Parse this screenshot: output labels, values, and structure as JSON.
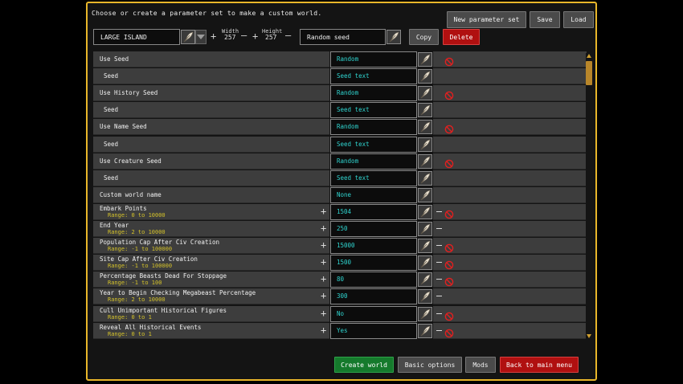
{
  "header": {
    "instruction": "Choose or create a parameter set to make a custom world.",
    "new_set_label": "New parameter set",
    "save_label": "Save",
    "load_label": "Load"
  },
  "selector": {
    "set_name": "LARGE ISLAND",
    "width_label": "Width",
    "width_value": "257",
    "height_label": "Height",
    "height_value": "257",
    "seed_field": "Random seed",
    "copy_label": "Copy",
    "delete_label": "Delete"
  },
  "rows": [
    {
      "label": "Use Seed",
      "sub": false,
      "value": "Random",
      "range": "",
      "plus": false,
      "minus": false,
      "no": true
    },
    {
      "label": "Seed",
      "sub": true,
      "value": "Seed text",
      "range": "",
      "plus": false,
      "minus": false,
      "no": false
    },
    {
      "label": "Use History Seed",
      "sub": false,
      "value": "Random",
      "range": "",
      "plus": false,
      "minus": false,
      "no": true
    },
    {
      "label": "Seed",
      "sub": true,
      "value": "Seed text",
      "range": "",
      "plus": false,
      "minus": false,
      "no": false
    },
    {
      "label": "Use Name Seed",
      "sub": false,
      "value": "Random",
      "range": "",
      "plus": false,
      "minus": false,
      "no": true
    },
    {
      "label": "Seed",
      "sub": true,
      "value": "Seed text",
      "range": "",
      "plus": false,
      "minus": false,
      "no": false
    },
    {
      "label": "Use Creature Seed",
      "sub": false,
      "value": "Random",
      "range": "",
      "plus": false,
      "minus": false,
      "no": true
    },
    {
      "label": "Seed",
      "sub": true,
      "value": "Seed text",
      "range": "",
      "plus": false,
      "minus": false,
      "no": false
    },
    {
      "label": "Custom world name",
      "sub": false,
      "value": "None",
      "range": "",
      "plus": false,
      "minus": false,
      "no": false
    },
    {
      "label": "Embark Points",
      "sub": false,
      "value": "1504",
      "range": "Range: 0 to 10000",
      "plus": true,
      "minus": true,
      "no": true
    },
    {
      "label": "End Year",
      "sub": false,
      "value": "250",
      "range": "Range: 2 to 10000",
      "plus": true,
      "minus": true,
      "no": false
    },
    {
      "label": "Population Cap After Civ Creation",
      "sub": false,
      "value": "15000",
      "range": "Range: -1 to 100000",
      "plus": true,
      "minus": true,
      "no": true
    },
    {
      "label": "Site Cap After Civ Creation",
      "sub": false,
      "value": "1500",
      "range": "Range: -1 to 100000",
      "plus": true,
      "minus": true,
      "no": true
    },
    {
      "label": "Percentage Beasts Dead For Stoppage",
      "sub": false,
      "value": "80",
      "range": "Range: -1 to 100",
      "plus": true,
      "minus": true,
      "no": true
    },
    {
      "label": "Year to Begin Checking Megabeast Percentage",
      "sub": false,
      "value": "300",
      "range": "Range: 2 to 10000",
      "plus": true,
      "minus": true,
      "no": false
    },
    {
      "label": "Cull Unimportant Historical Figures",
      "sub": false,
      "value": "No",
      "range": "Range: 0 to 1",
      "plus": true,
      "minus": true,
      "no": true
    },
    {
      "label": "Reveal All Historical Events",
      "sub": false,
      "value": "Yes",
      "range": "Range: 0 to 1",
      "plus": true,
      "minus": true,
      "no": true
    }
  ],
  "footer": {
    "create_label": "Create world",
    "basic_label": "Basic options",
    "mods_label": "Mods",
    "back_label": "Back to main menu"
  },
  "icons": {
    "edit": "quill-icon",
    "disable": "no-entry-icon",
    "dropdown": "triangle-down-icon"
  },
  "colors": {
    "frame": "#e8b62a",
    "value_text": "#2fd4cf",
    "range_text": "#d4c22a",
    "delete": "#b01010",
    "create": "#157a2c",
    "no_icon": "#e02020"
  }
}
